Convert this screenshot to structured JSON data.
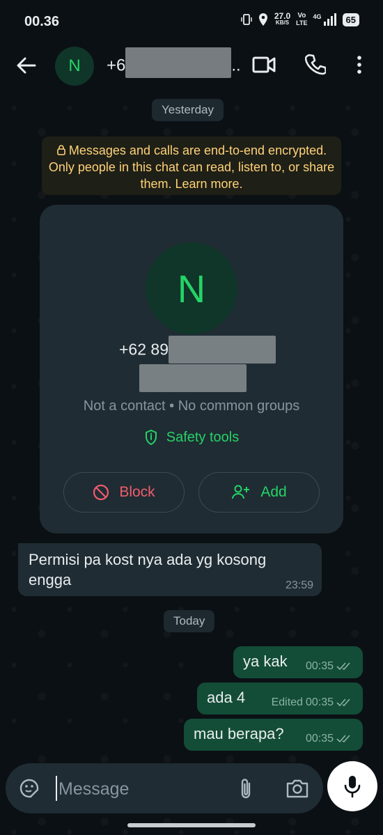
{
  "status": {
    "time": "00.36",
    "speed": "27.0",
    "speed_unit": "KB/S",
    "volte_top": "Vo",
    "volte_bottom": "LTE",
    "network": "4G",
    "battery": "65"
  },
  "header": {
    "avatar_initial": "N",
    "contact_prefix": "+6",
    "contact_suffix": ".."
  },
  "chat": {
    "date_yesterday": "Yesterday",
    "encryption_notice": "Messages and calls are end-to-end encrypted. Only people in this chat can read, listen to, or share them. Learn more.",
    "card": {
      "avatar_initial": "N",
      "number_prefix": "+62 89",
      "subtitle": "Not a contact • No common groups",
      "safety_label": "Safety tools",
      "block_label": "Block",
      "add_label": "Add"
    },
    "incoming": {
      "text": "Permisi pa kost nya ada yg kosong engga",
      "time": "23:59"
    },
    "date_today": "Today",
    "outgoing": [
      {
        "text": "ya kak",
        "edited": "",
        "time": "00:35"
      },
      {
        "text": "ada 4",
        "edited": "Edited",
        "time": "00:35"
      },
      {
        "text": "mau berapa?",
        "edited": "",
        "time": "00:35"
      }
    ]
  },
  "composer": {
    "placeholder": "Message"
  },
  "colors": {
    "accent": "#25d366",
    "outgoing_bubble": "#134d37",
    "incoming_bubble": "#1f2c33",
    "danger": "#f15c6d",
    "notice": "#ffd279"
  }
}
